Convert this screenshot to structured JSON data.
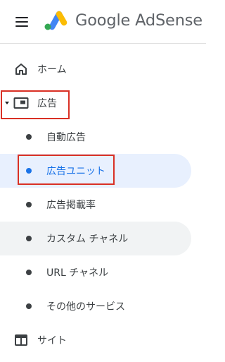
{
  "header": {
    "menu_icon": "hamburger-menu-icon",
    "logo_icon": "adsense-logo-icon",
    "brand": "Google AdSense"
  },
  "nav": {
    "home": {
      "label": "ホーム",
      "icon": "home-icon"
    },
    "ads": {
      "label": "広告",
      "icon": "ads-icon",
      "expanded": true
    },
    "auto_ads": {
      "label": "自動広告"
    },
    "ad_units": {
      "label": "広告ユニット",
      "active": true
    },
    "ad_coverage": {
      "label": "広告掲載率"
    },
    "custom_channels": {
      "label": "カスタム チャネル"
    },
    "url_channels": {
      "label": "URL チャネル"
    },
    "other_services": {
      "label": "その他のサービス"
    },
    "sites": {
      "label": "サイト",
      "icon": "sites-icon"
    }
  },
  "colors": {
    "active_bg": "#e8f0fe",
    "active_text": "#1a73e8",
    "hover_bg": "#f1f3f4",
    "annotation": "#d93025"
  }
}
